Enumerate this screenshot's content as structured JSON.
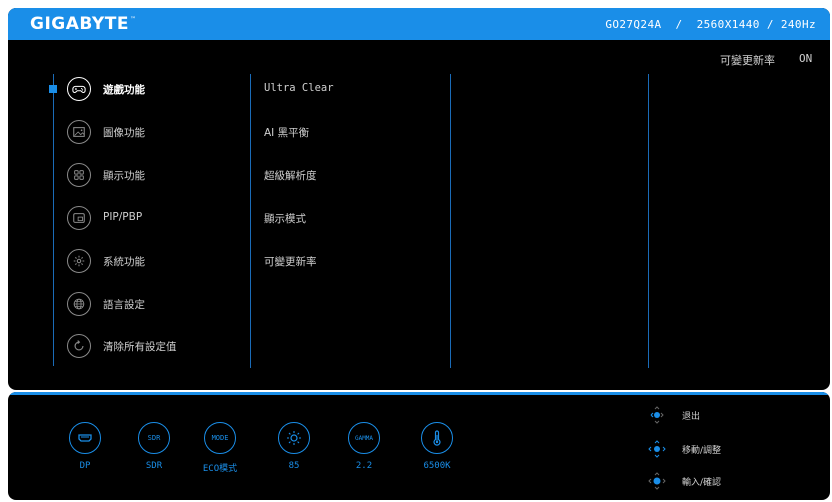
{
  "header": {
    "logo": "GIGABYTE",
    "logo_tm": "™",
    "model_info": "GO27Q24A  /  2560X1440 / 240Hz"
  },
  "vrr": {
    "label": "可變更新率",
    "value": "ON"
  },
  "nav": {
    "items": [
      {
        "label": "遊戲功能",
        "icon": "gamepad-icon",
        "active": true
      },
      {
        "label": "圖像功能",
        "icon": "picture-icon"
      },
      {
        "label": "顯示功能",
        "icon": "display-grid-icon"
      },
      {
        "label": "PIP/PBP",
        "icon": "pip-icon"
      },
      {
        "label": "系統功能",
        "icon": "gear-icon"
      },
      {
        "label": "語言設定",
        "icon": "globe-icon"
      },
      {
        "label": "清除所有設定值",
        "icon": "reset-icon"
      }
    ]
  },
  "submenu": {
    "items": [
      "Ultra Clear",
      "AI 黑平衡",
      "超級解析度",
      "顯示模式",
      "可變更新率"
    ]
  },
  "status": {
    "items": [
      {
        "icon": "hdmi-input-icon",
        "value": "DP"
      },
      {
        "icon_text": "SDR",
        "value": "SDR"
      },
      {
        "icon_text": "MODE",
        "value": "ECO模式"
      },
      {
        "icon": "brightness-icon",
        "value": "85"
      },
      {
        "icon_text": "GAMMA",
        "value": "2.2"
      },
      {
        "icon": "thermometer-icon",
        "value": "6500K"
      }
    ]
  },
  "hints": {
    "items": [
      {
        "icon": "joystick-left-icon",
        "label": "退出"
      },
      {
        "icon": "joystick-move-icon",
        "label": "移動/調整"
      },
      {
        "icon": "joystick-press-icon",
        "label": "輸入/確認"
      }
    ]
  },
  "colors": {
    "accent": "#1a8ee8",
    "background": "#000000",
    "divider": "#1a6bb8"
  }
}
